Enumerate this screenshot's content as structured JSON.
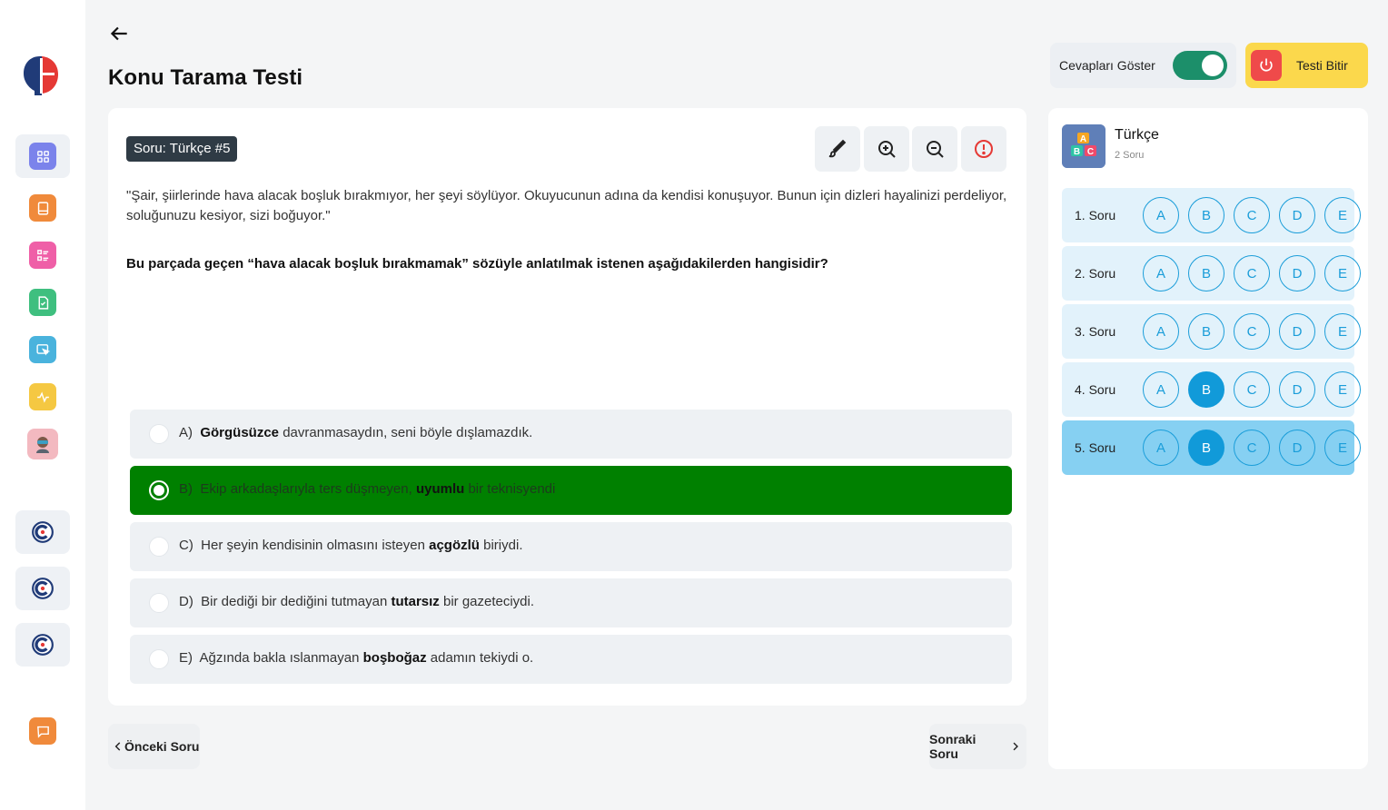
{
  "header": {
    "title": "Konu Tarama Testi",
    "show_answers_label": "Cevapları Göster",
    "show_answers_on": true,
    "finish_label": "Testi Bitir"
  },
  "question": {
    "badge": "Soru: Türkçe #5",
    "passage": "\"Şair, şiirlerinde hava alacak boşluk bırakmıyor, her şeyi söylüyor. Okuyucunun adına da kendisi konuşuyor. Bunun için dizleri hayalinizi perdeliyor, soluğunuzu kesiyor, sizi boğuyor.\"",
    "prompt": "Bu parçada geçen “hava alacak boşluk bırakmamak” sözüyle anlatılmak istenen aşağıdakilerden hangisidir?",
    "options": [
      {
        "letter": "A)",
        "pre": "",
        "bold": "Görgüsüzce",
        "post": " davranmasaydın, seni böyle dışlamazdık."
      },
      {
        "letter": "B)",
        "pre": "Ekip arkadaşlarıyla ters düşmeyen, ",
        "bold": "uyumlu",
        "post": " bir teknisyendi"
      },
      {
        "letter": "C)",
        "pre": "Her şeyin kendisinin olmasını isteyen ",
        "bold": "açgözlü",
        "post": " biriydi."
      },
      {
        "letter": "D)",
        "pre": "Bir dediği bir dediğini tutmayan ",
        "bold": "tutarsız",
        "post": " bir gazeteciydi."
      },
      {
        "letter": "E)",
        "pre": "Ağzında bakla ıslanmayan ",
        "bold": "boşboğaz",
        "post": " adamın tekiydi o."
      }
    ],
    "selected": "B"
  },
  "nav": {
    "prev": "Önceki Soru",
    "next": "Sonraki Soru"
  },
  "panel": {
    "subject": "Türkçe",
    "count": "2 Soru",
    "letters": [
      "A",
      "B",
      "C",
      "D",
      "E"
    ],
    "rows": [
      {
        "label": "1. Soru",
        "answer": null
      },
      {
        "label": "2. Soru",
        "answer": null
      },
      {
        "label": "3. Soru",
        "answer": null
      },
      {
        "label": "4. Soru",
        "answer": "B"
      },
      {
        "label": "5. Soru",
        "answer": "B"
      }
    ],
    "current_row": 4
  },
  "sidebar": {
    "items": [
      {
        "icon": "grid-icon",
        "color": "#7b83eb"
      },
      {
        "icon": "book-icon",
        "color": "#f08a3b"
      },
      {
        "icon": "list-icon",
        "color": "#ef5fa7"
      },
      {
        "icon": "file-check-icon",
        "color": "#3fbf7f"
      },
      {
        "icon": "cursor-screen-icon",
        "color": "#4ab3dd"
      },
      {
        "icon": "activity-icon",
        "color": "#f5c842"
      },
      {
        "icon": "avatar-icon",
        "color": "#f3b9c0"
      }
    ],
    "tiles": 3,
    "chat_color": "#f08a3b"
  },
  "colors": {
    "selected_option": "#008000",
    "bubble": "#1a9dd9",
    "finish": "#fbd84c",
    "toggle": "#1c8f6a"
  }
}
